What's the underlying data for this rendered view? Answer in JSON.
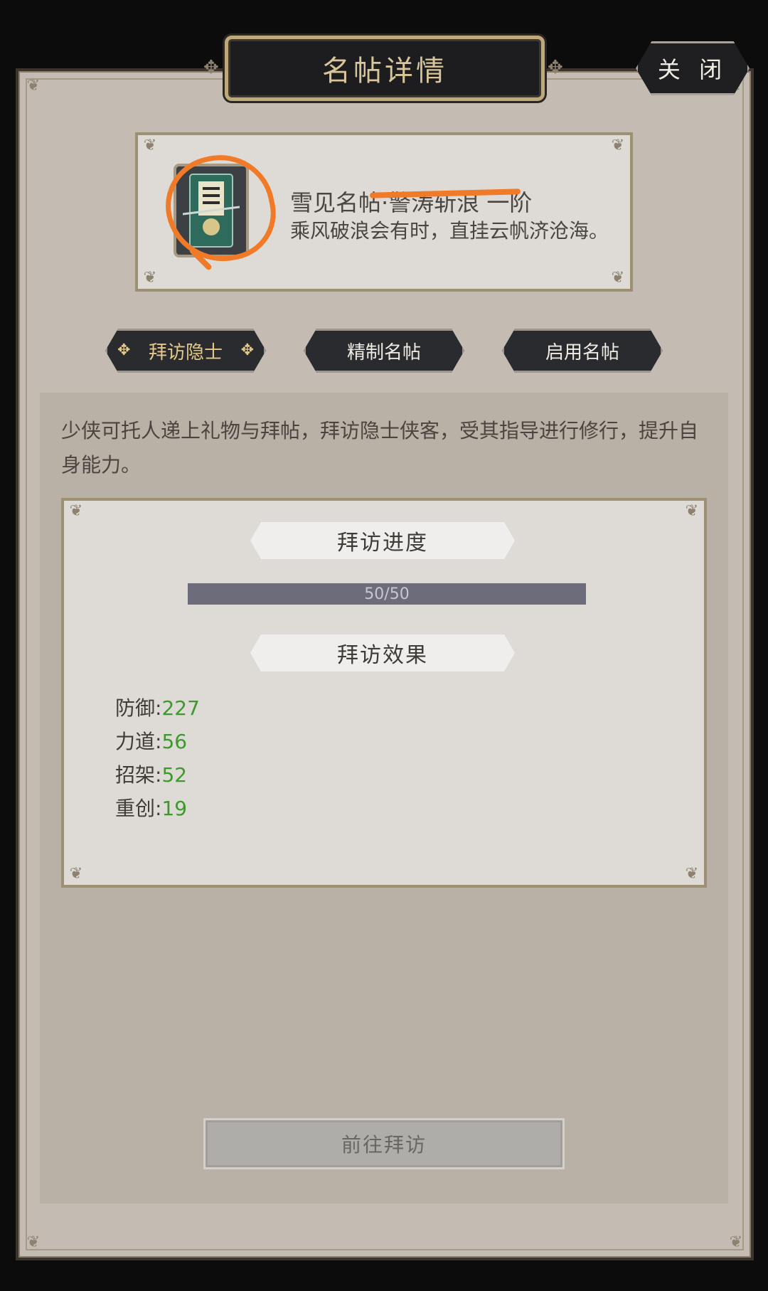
{
  "header": {
    "title": "名帖详情",
    "close_label": "关 闭"
  },
  "card": {
    "name": "雪见名帖·警涛斩浪 一阶",
    "description": "乘风破浪会有时，直挂云帆济沧海。",
    "icon": "name-card-icon"
  },
  "tabs": [
    {
      "label": "拜访隐士",
      "active": true
    },
    {
      "label": "精制名帖",
      "active": false
    },
    {
      "label": "启用名帖",
      "active": false
    }
  ],
  "content": {
    "intro": "少侠可托人递上礼物与拜帖，拜访隐士侠客，受其指导进行修行，提升自身能力。",
    "progress_section": {
      "title": "拜访进度",
      "current": 50,
      "max": 50,
      "text": "50/50"
    },
    "effect_section": {
      "title": "拜访效果",
      "stats": [
        {
          "label": "防御:",
          "value": "227"
        },
        {
          "label": "力道:",
          "value": "56"
        },
        {
          "label": "招架:",
          "value": "52"
        },
        {
          "label": "重创:",
          "value": "19"
        }
      ]
    },
    "go_button_label": "前往拜访"
  },
  "colors": {
    "stat_value": "#3b9a2b",
    "annotation": "#f07a28",
    "title_text": "#d8c59a"
  }
}
